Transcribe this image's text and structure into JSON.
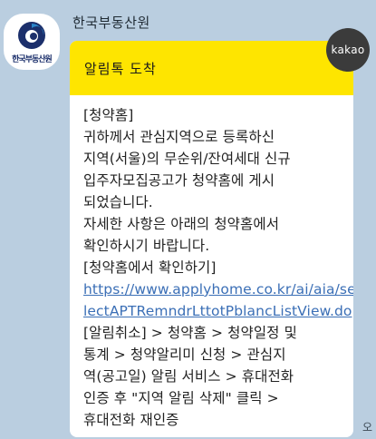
{
  "sender": {
    "name": "한국부동산원",
    "avatar_text": "한국부동산원",
    "avatar_icon": "korea-real-estate-board-logo"
  },
  "badge": {
    "label": "kakao"
  },
  "message": {
    "header": "알림톡 도착",
    "lines": [
      "[청약홈]",
      "귀하께서 관심지역으로 등록하신",
      "지역(서울)의 무순위/잔여세대 신규",
      " 입주자모집공고가 청약홈에 게시",
      "되었습니다.",
      "자세한 사항은 아래의 청약홈에서",
      "확인하시기 바랍니다.",
      "[청약홈에서 확인하기]"
    ],
    "link_lines": [
      "https://www.applyhome.co.kr/ai/aia/se",
      "lectAPTRemndrLttotPblancListView.do"
    ],
    "tail_lines": [
      "[알림취소] > 청약홈 > 청약일정 및",
      " 통계 > 청약알리미 신청 > 관심지",
      "역(공고일) 알림 서비스 > 휴대전화",
      " 인증 후 \"지역 알림 삭제\" 클릭 >",
      "휴대전화 재인증"
    ]
  },
  "time_fragment": "오",
  "colors": {
    "background": "#bacee0",
    "header_yellow": "#fee500",
    "link": "#3b6fb6",
    "badge": "#3b3b3b",
    "logo_navy": "#1b2f6b",
    "logo_blue": "#2a86c9"
  }
}
